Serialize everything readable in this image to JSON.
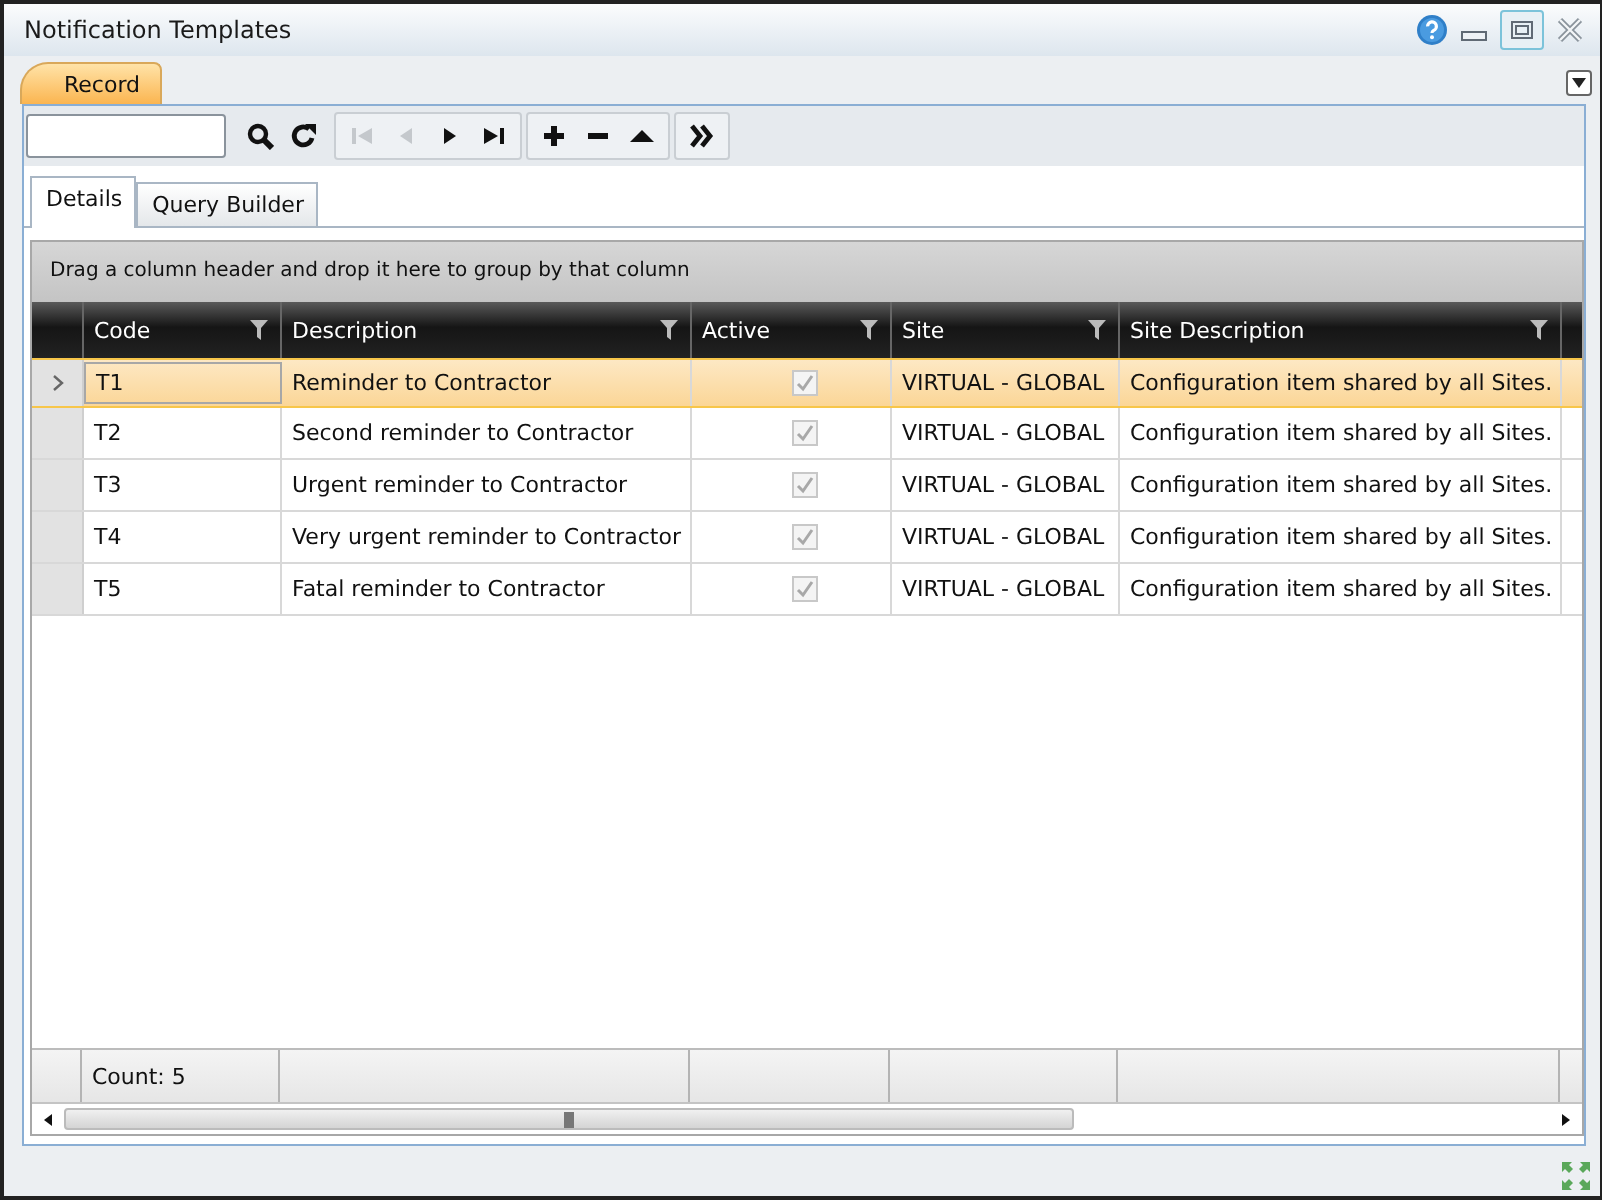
{
  "window": {
    "title": "Notification Templates"
  },
  "ribbon_tabs": [
    {
      "label": "Record",
      "selected": true
    }
  ],
  "toolbar": {
    "groups": [
      [
        {
          "kind": "search",
          "disabled": false
        },
        {
          "kind": "refresh",
          "disabled": false
        }
      ],
      [
        {
          "kind": "first",
          "disabled": true
        },
        {
          "kind": "prev",
          "disabled": true
        },
        {
          "kind": "next",
          "disabled": false
        },
        {
          "kind": "last",
          "disabled": false
        }
      ],
      [
        {
          "kind": "add",
          "disabled": false
        },
        {
          "kind": "remove",
          "disabled": false
        },
        {
          "kind": "up",
          "disabled": false
        }
      ],
      [
        {
          "kind": "more",
          "disabled": false
        }
      ]
    ]
  },
  "detail_tabs": [
    {
      "label": "Details",
      "selected": true
    },
    {
      "label": "Query Builder",
      "selected": false
    }
  ],
  "grid": {
    "group_hint": "Drag a column header and drop it here to group by that column",
    "columns": [
      {
        "label": "Code"
      },
      {
        "label": "Description"
      },
      {
        "label": "Active"
      },
      {
        "label": "Site"
      },
      {
        "label": "Site Description"
      }
    ],
    "rows": [
      {
        "selected": true,
        "code": "T1",
        "description": "Reminder to Contractor",
        "active": true,
        "site": "VIRTUAL - GLOBAL",
        "site_description": "Configuration item shared by all Sites."
      },
      {
        "selected": false,
        "code": "T2",
        "description": "Second reminder to Contractor",
        "active": true,
        "site": "VIRTUAL - GLOBAL",
        "site_description": "Configuration item shared by all Sites."
      },
      {
        "selected": false,
        "code": "T3",
        "description": "Urgent reminder to Contractor",
        "active": true,
        "site": "VIRTUAL - GLOBAL",
        "site_description": "Configuration item shared by all Sites."
      },
      {
        "selected": false,
        "code": "T4",
        "description": "Very urgent reminder to Contractor",
        "active": true,
        "site": "VIRTUAL - GLOBAL",
        "site_description": "Configuration item shared by all Sites."
      },
      {
        "selected": false,
        "code": "T5",
        "description": "Fatal reminder to Contractor",
        "active": true,
        "site": "VIRTUAL - GLOBAL",
        "site_description": "Configuration item shared by all Sites."
      }
    ],
    "footer": {
      "count": "Count: 5"
    }
  }
}
